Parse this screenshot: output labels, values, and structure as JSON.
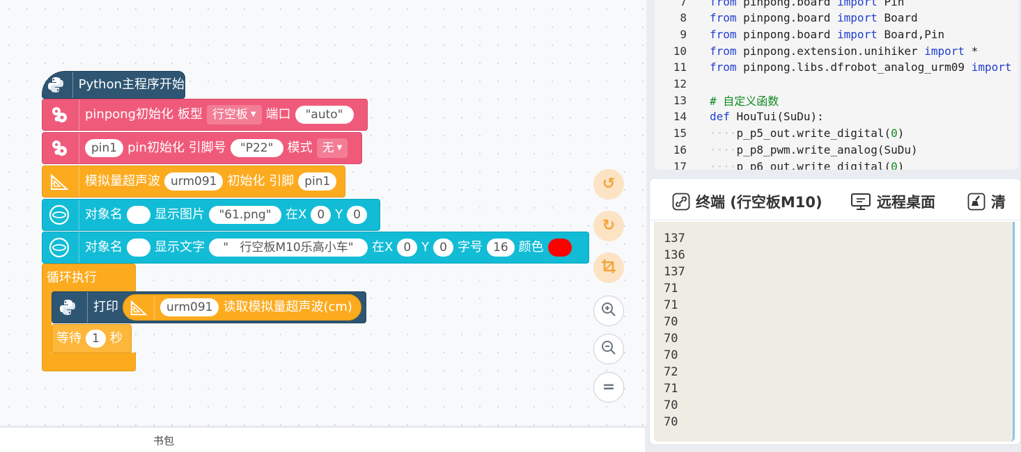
{
  "blocks": {
    "main": "Python主程序开始",
    "init_board": {
      "label": "pinpong初始化 板型",
      "board": "行空板",
      "port_label": "端口",
      "port": "\"auto\""
    },
    "init_pin": {
      "pin": "pin1",
      "label": "pin初始化 引脚号",
      "pin_no": "\"P22\"",
      "mode_label": "模式",
      "mode": "无"
    },
    "ultrasonic_init": {
      "label": "模拟量超声波",
      "name": "urm091",
      "init_label": "初始化 引脚",
      "pin": "pin1"
    },
    "show_image": {
      "obj_label": "对象名",
      "action": "显示图片",
      "file": "\"61.png\"",
      "x_label": "在X",
      "x": "0",
      "y_label": "Y",
      "y": "0"
    },
    "show_text": {
      "obj_label": "对象名",
      "action": "显示文字",
      "text": "\"   行空板M10乐高小车\"",
      "x_label": "在X",
      "x": "0",
      "y_label": "Y",
      "y": "0",
      "size_label": "字号",
      "size": "16",
      "color_label": "颜色",
      "color": "#ff0000"
    },
    "loop": "循环执行",
    "print": {
      "label": "打印",
      "name": "urm091",
      "read_label": "读取模拟量超声波(cm)"
    },
    "wait": {
      "label": "等待",
      "value": "1",
      "unit": "秒"
    }
  },
  "bottom_bar": {
    "label": "书包"
  },
  "code_lines": [
    {
      "n": "7",
      "parts": [
        [
          "from",
          "kw"
        ],
        [
          " pinpong.board ",
          ""
        ],
        [
          "import",
          "kw"
        ],
        [
          " Pin",
          ""
        ]
      ]
    },
    {
      "n": "8",
      "parts": [
        [
          "from",
          "kw"
        ],
        [
          " pinpong.board ",
          ""
        ],
        [
          "import",
          "kw"
        ],
        [
          " Board",
          ""
        ]
      ]
    },
    {
      "n": "9",
      "parts": [
        [
          "from",
          "kw"
        ],
        [
          " pinpong.board ",
          ""
        ],
        [
          "import",
          "kw"
        ],
        [
          " Board,Pin",
          ""
        ]
      ]
    },
    {
      "n": "10",
      "parts": [
        [
          "from",
          "kw"
        ],
        [
          " pinpong.extension.unihiker ",
          ""
        ],
        [
          "import",
          "kw"
        ],
        [
          " *",
          ""
        ]
      ]
    },
    {
      "n": "11",
      "parts": [
        [
          "from",
          "kw"
        ],
        [
          " pinpong.libs.dfrobot_analog_urm09 ",
          ""
        ],
        [
          "import",
          "kw"
        ]
      ]
    },
    {
      "n": "12",
      "parts": []
    },
    {
      "n": "13",
      "parts": [
        [
          "# 自定义函数",
          "cm"
        ]
      ]
    },
    {
      "n": "14",
      "parts": [
        [
          "def",
          "kw"
        ],
        [
          " HouTui(SuDu):",
          ""
        ]
      ]
    },
    {
      "n": "15",
      "parts": [
        [
          "····",
          "ind"
        ],
        [
          "p_p5_out.write_digital(",
          ""
        ],
        [
          "0",
          "num"
        ],
        [
          ")",
          ""
        ]
      ]
    },
    {
      "n": "16",
      "parts": [
        [
          "····",
          "ind"
        ],
        [
          "p_p8_pwm.write_analog(SuDu)",
          ""
        ]
      ]
    },
    {
      "n": "17",
      "parts": [
        [
          "····",
          "ind"
        ],
        [
          "p_p6_out.write_digital(",
          ""
        ],
        [
          "0",
          "num"
        ],
        [
          ")",
          ""
        ]
      ]
    }
  ],
  "terminal": {
    "tabs": [
      "终端 (行空板M10)",
      "远程桌面",
      "清"
    ],
    "lines": [
      "137",
      "136",
      "137",
      "71",
      "71",
      "70",
      "70",
      "70",
      "72",
      "71",
      "70",
      "70"
    ]
  },
  "icons": {
    "main": "python-icon",
    "init": "dragon-icon",
    "ultrasonic": "ultrasonic-icon",
    "screen": "screen-object-icon",
    "undo": "undo-icon",
    "redo": "redo-icon",
    "crop": "crop-icon",
    "zoom_in": "zoom-in-icon",
    "zoom_out": "zoom-out-icon",
    "reset": "reset-zoom-icon",
    "link": "link-icon",
    "desktop": "desktop-icon",
    "broom": "broom-icon"
  }
}
